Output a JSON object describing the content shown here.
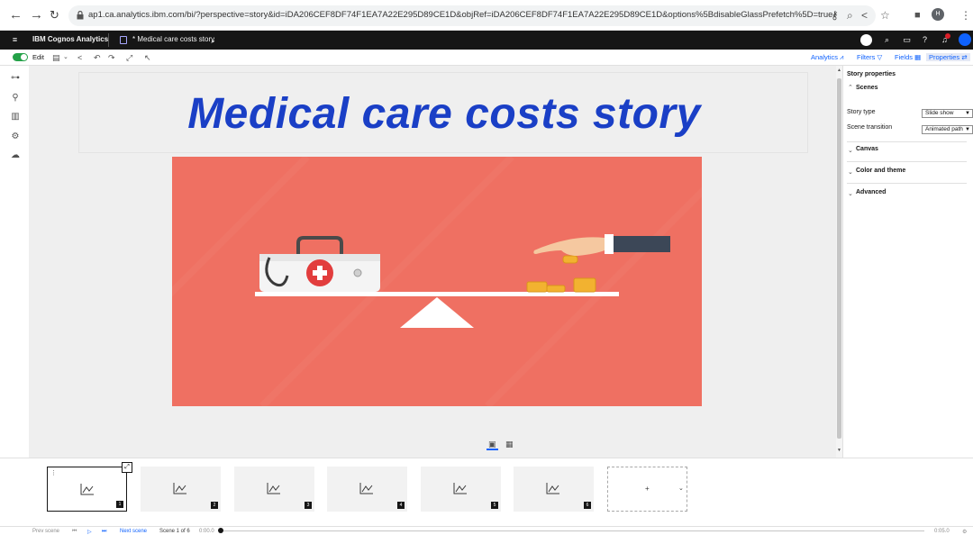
{
  "browser": {
    "url": "ap1.ca.analytics.ibm.com/bi/?perspective=story&id=iDA206CEF8DF74F1EA7A22E295D89CE1D&objRef=iDA206CEF8DF74F1EA7A22E295D89CE1D&options%5BdisableGlassPrefetch%5D=true&options%5Bcollections%5D%5Bca...",
    "profile_initial": "H",
    "icons": [
      "back-arrow-icon",
      "forward-arrow-icon",
      "reload-icon",
      "lock-icon",
      "key-icon",
      "zoom-icon",
      "share-icon",
      "star-icon",
      "tab-square-icon",
      "menu-kebab-icon"
    ]
  },
  "app": {
    "product": "IBM Cognos Analytics",
    "tab_title": "* Medical care costs story"
  },
  "toolbar": {
    "edit_label": "Edit",
    "analytics_label": "Analytics",
    "filters_label": "Filters",
    "fields_label": "Fields",
    "properties_label": "Properties"
  },
  "canvas": {
    "title": "Medical care costs story"
  },
  "properties": {
    "panel_title": "Story properties",
    "scenes_label": "Scenes",
    "story_type_label": "Story type",
    "story_type_value": "Slide show",
    "scene_transition_label": "Scene transition",
    "scene_transition_value": "Animated path",
    "canvas_label": "Canvas",
    "color_theme_label": "Color and theme",
    "advanced_label": "Advanced"
  },
  "filmstrip": {
    "scenes": [
      "1",
      "2",
      "3",
      "4",
      "5",
      "6"
    ],
    "add_symbol": "+"
  },
  "footer": {
    "prev_scene": "Prev scene",
    "next_scene": "Next scene",
    "scene_counter": "Scene 1 of 6",
    "time_start": "0:00.0",
    "time_end": "0:05.0"
  },
  "colors": {
    "accent": "#0f62fe",
    "title_blue": "#1a3fc6",
    "hero_bg": "#ef7062",
    "header_bg": "#161616",
    "toggle_green": "#24a148"
  }
}
